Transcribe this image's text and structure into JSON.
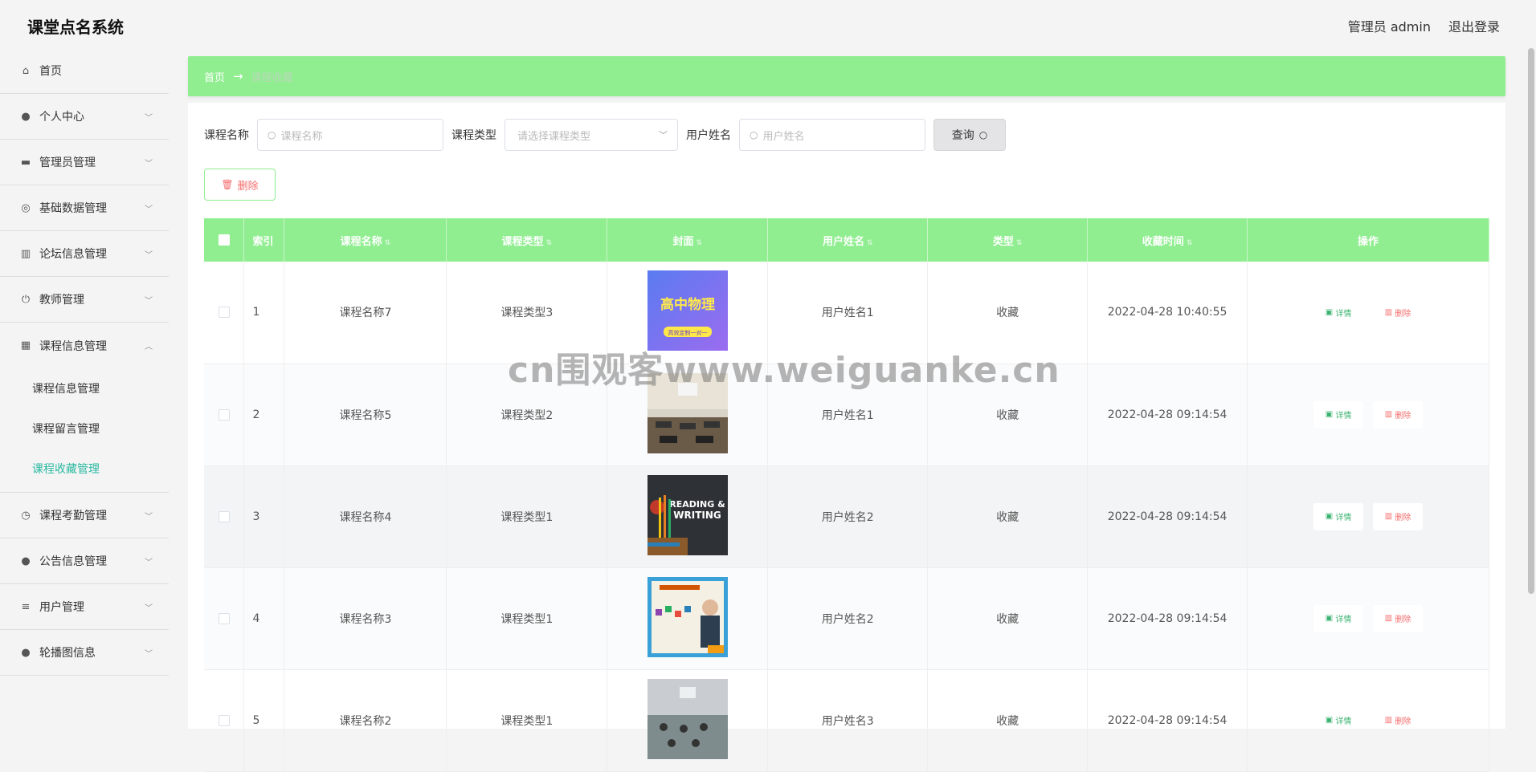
{
  "header": {
    "title": "课堂点名系统",
    "user": "管理员 admin",
    "logout": "退出登录"
  },
  "sidebar": {
    "items": [
      {
        "label": "首页",
        "icon": "home-icon",
        "glyph": "⌂"
      },
      {
        "label": "个人中心",
        "icon": "user-icon",
        "glyph": "●"
      },
      {
        "label": "管理员管理",
        "icon": "briefcase-icon",
        "glyph": "▬"
      },
      {
        "label": "基础数据管理",
        "icon": "compass-icon",
        "glyph": "◎"
      },
      {
        "label": "论坛信息管理",
        "icon": "chart-icon",
        "glyph": "▥"
      },
      {
        "label": "教师管理",
        "icon": "power-icon",
        "glyph": "⏻"
      },
      {
        "label": "课程信息管理",
        "icon": "grid-icon",
        "glyph": "▦"
      },
      {
        "label": "课程考勤管理",
        "icon": "clock-icon",
        "glyph": "◷"
      },
      {
        "label": "公告信息管理",
        "icon": "user-icon",
        "glyph": "●"
      },
      {
        "label": "用户管理",
        "icon": "list-icon",
        "glyph": "≡"
      },
      {
        "label": "轮播图信息",
        "icon": "bulb-icon",
        "glyph": "●"
      }
    ],
    "submenu": [
      "课程信息管理",
      "课程留言管理",
      "课程收藏管理"
    ]
  },
  "breadcrumb": {
    "home": "首页",
    "current": "课程收藏"
  },
  "search": {
    "course_name_label": "课程名称",
    "course_name_placeholder": "课程名称",
    "course_type_label": "课程类型",
    "course_type_placeholder": "请选择课程类型",
    "user_name_label": "用户姓名",
    "user_name_placeholder": "用户姓名",
    "query_label": "查询"
  },
  "toolbar": {
    "delete_label": "删除"
  },
  "table": {
    "headers": [
      "索引",
      "课程名称",
      "课程类型",
      "封面",
      "用户姓名",
      "类型",
      "收藏时间",
      "操作"
    ],
    "detail_label": "详情",
    "remove_label": "删除",
    "rows": [
      {
        "index": "1",
        "course": "课程名称7",
        "type": "课程类型3",
        "cover_text": "高中物理",
        "cover_sub": "高效定制一对一",
        "user": "用户姓名1",
        "kind": "收藏",
        "time": "2022-04-28 10:40:55"
      },
      {
        "index": "2",
        "course": "课程名称5",
        "type": "课程类型2",
        "user": "用户姓名1",
        "kind": "收藏",
        "time": "2022-04-28 09:14:54"
      },
      {
        "index": "3",
        "course": "课程名称4",
        "type": "课程类型1",
        "cover_text": "READING &",
        "cover_sub": "WRITING",
        "user": "用户姓名2",
        "kind": "收藏",
        "time": "2022-04-28 09:14:54"
      },
      {
        "index": "4",
        "course": "课程名称3",
        "type": "课程类型1",
        "user": "用户姓名2",
        "kind": "收藏",
        "time": "2022-04-28 09:14:54"
      },
      {
        "index": "5",
        "course": "课程名称2",
        "type": "课程类型1",
        "user": "用户姓名3",
        "kind": "收藏",
        "time": "2022-04-28 09:14:54"
      }
    ]
  },
  "watermark": "cn围观客www.weiguanke.cn"
}
